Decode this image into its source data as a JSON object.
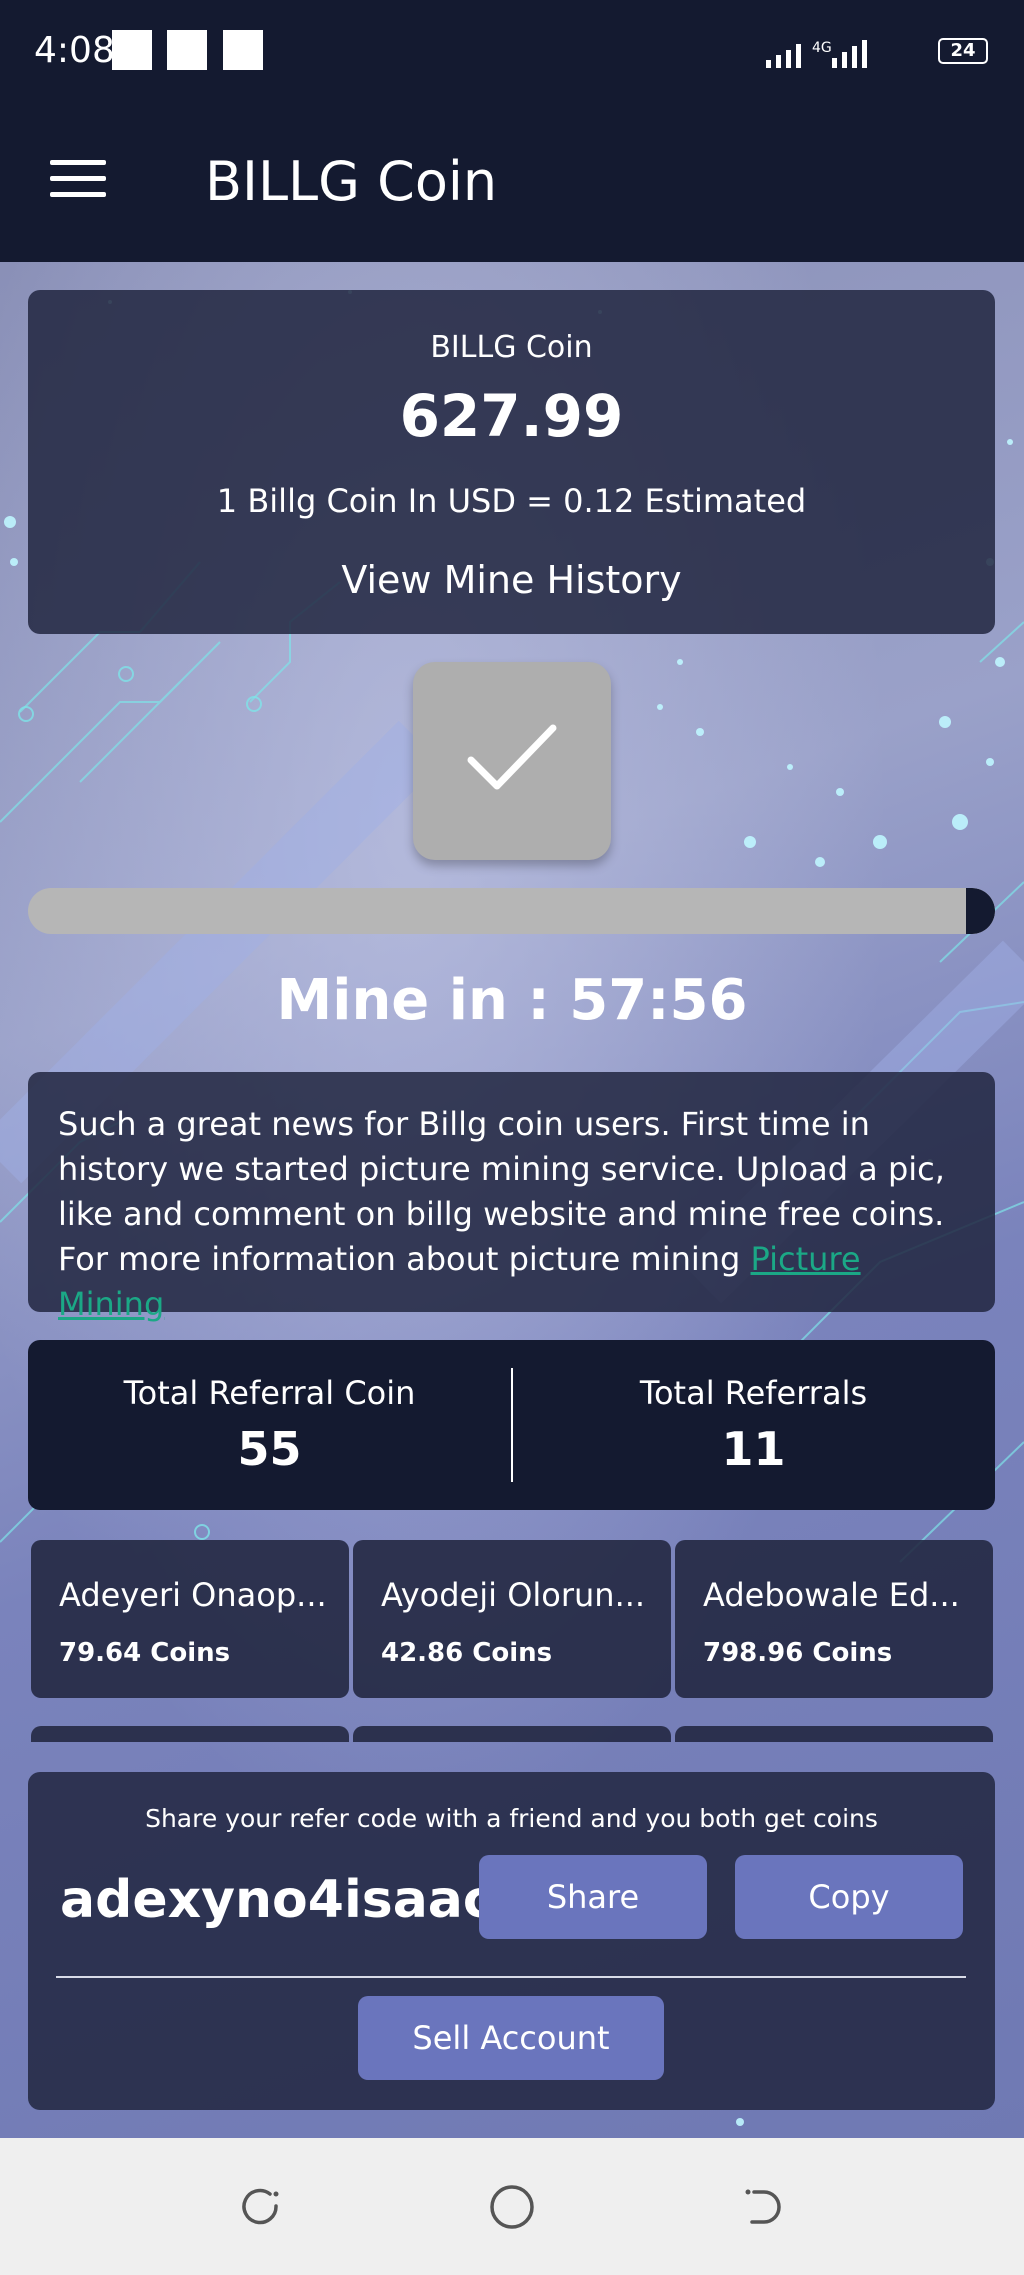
{
  "status_bar": {
    "time": "4:08",
    "network": "4G",
    "battery": "24"
  },
  "app_bar": {
    "title": "BILLG Coin"
  },
  "balance": {
    "coin_name": "BILLG Coin",
    "amount": "627.99",
    "rate_text": "1 Billg Coin In USD = 0.12 Estimated",
    "history_link": "View Mine History"
  },
  "mining": {
    "progress_fraction": 0.03,
    "timer_text": "Mine in : 57:56"
  },
  "news": {
    "text": "Such a great news for Billg coin users. First time in history we started picture mining service. Upload a pic, like and comment on billg website and mine free coins. For more information about picture mining ",
    "link_text": "Picture Mining"
  },
  "referral_stats": {
    "coin_label": "Total Referral Coin",
    "coin_value": "55",
    "count_label": "Total Referrals",
    "count_value": "11"
  },
  "referrals": [
    {
      "name": "Adeyeri Onaop...",
      "coins": "79.64 Coins"
    },
    {
      "name": "Ayodeji Olorun...",
      "coins": "42.86 Coins"
    },
    {
      "name": "Adebowale Ed...",
      "coins": "798.96 Coins"
    }
  ],
  "share": {
    "message": "Share your refer code with a friend and you both get coins",
    "code": "adexyno4isaac",
    "share_label": "Share",
    "copy_label": "Copy",
    "sell_label": "Sell Account"
  },
  "colors": {
    "dark_navy": "#141a30",
    "button_blue": "#6a75bd",
    "link_green": "#1ba886",
    "mine_button_gray": "#aeaeae"
  }
}
